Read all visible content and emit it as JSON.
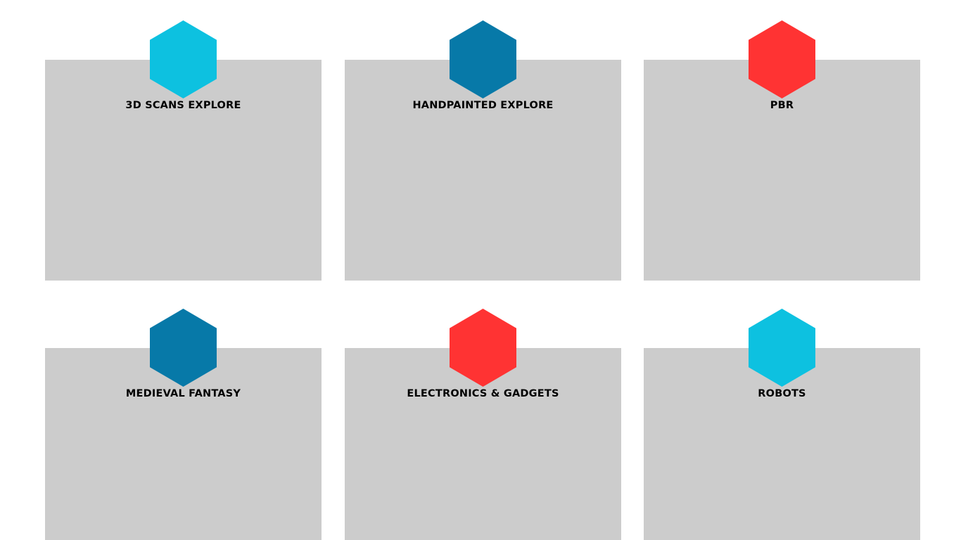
{
  "categories": [
    {
      "title": "3D SCANS EXPLORE",
      "hex_color": "#0dc1e0"
    },
    {
      "title": "HANDPAINTED EXPLORE",
      "hex_color": "#0779a8"
    },
    {
      "title": "PBR",
      "hex_color": "#ff3333"
    },
    {
      "title": "MEDIEVAL FANTASY",
      "hex_color": "#0779a8"
    },
    {
      "title": "ELECTRONICS & GADGETS",
      "hex_color": "#ff3333"
    },
    {
      "title": "ROBOTS",
      "hex_color": "#0dc1e0"
    }
  ],
  "colors": {
    "card_background": "#cccccc",
    "page_background": "#ffffff",
    "title_text": "#000000"
  },
  "icons": {
    "hexagon": "hexagon-icon"
  }
}
